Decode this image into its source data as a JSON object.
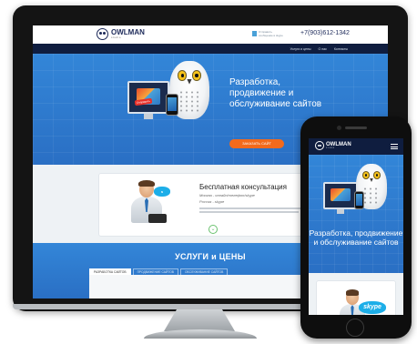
{
  "site": {
    "logo_name": "OWLMAN",
    "logo_sub": "studio",
    "phone": "+7(903)612-1342",
    "contact_note": "Отправить сообщение в skype",
    "nav": [
      "Услуги и цены",
      "О нас",
      "Контакты"
    ],
    "hero_title": "Разработка, продвижение и обслуживание сайтов",
    "hero_button": "ЗАКАЗАТЬ САЙТ",
    "hero_tag": "Отправить",
    "consult": {
      "title": "Бесплатная консультация",
      "line1": "Москва - онлайн/телефон/skype",
      "line2": "Россия - skype"
    },
    "services_title": "УСЛУГИ и ЦЕНЫ",
    "tabs": [
      {
        "label": "РАЗРАБОТКА САЙТОВ",
        "active": true
      },
      {
        "label": "ПРОДВИЖЕНИЕ САЙТОВ",
        "active": false
      },
      {
        "label": "ОБСЛУЖИВАНИЕ САЙТОВ",
        "active": false
      }
    ]
  },
  "phone_view": {
    "logo_name": "OWLMAN",
    "logo_sub": "studio",
    "hero_title": "Разработка, продвижение и обслуживание сайтов",
    "skype_label": "skype"
  },
  "colors": {
    "hero_blue": "#2f7ed3",
    "nav_dark": "#0f1d3f",
    "accent_orange": "#f36a1c",
    "skype_blue": "#1daee8"
  }
}
